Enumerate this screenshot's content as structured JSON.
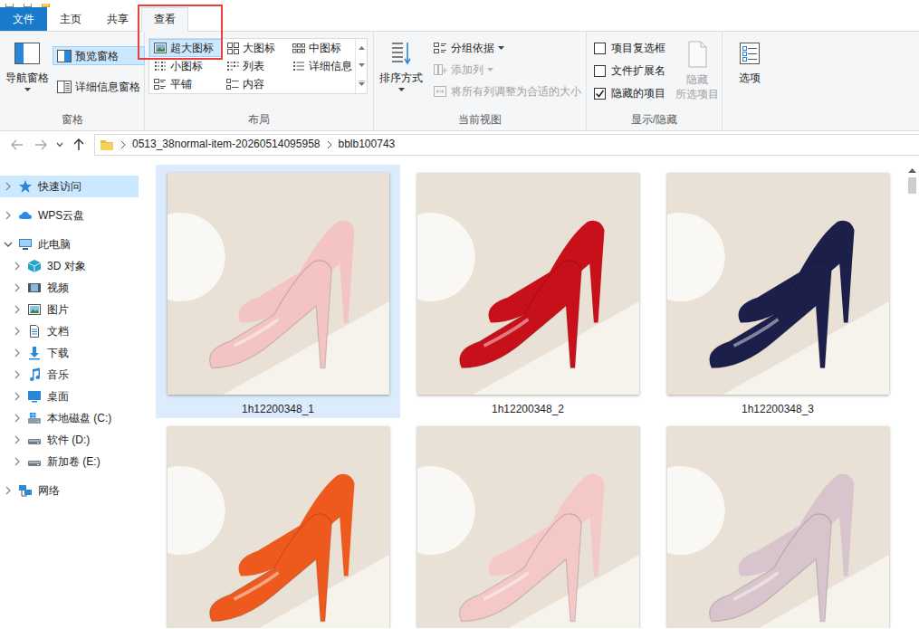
{
  "ribbon": {
    "tabs": [
      {
        "label": "文件",
        "kind": "file",
        "selected": false,
        "annotated": false
      },
      {
        "label": "主页",
        "kind": "tab",
        "selected": false,
        "annotated": false
      },
      {
        "label": "共享",
        "kind": "tab",
        "selected": false,
        "annotated": false
      },
      {
        "label": "查看",
        "kind": "tab",
        "selected": true,
        "annotated": true
      }
    ],
    "panes": {
      "title": "窗格",
      "navigation": {
        "label": "导航窗格"
      },
      "buttons": [
        {
          "label": "预览窗格",
          "selected": true
        },
        {
          "label": "详细信息窗格",
          "selected": false
        }
      ]
    },
    "layout": {
      "title": "布局",
      "options": [
        {
          "label": "超大图标",
          "selected": true
        },
        {
          "label": "大图标",
          "selected": false
        },
        {
          "label": "中图标",
          "selected": false
        },
        {
          "label": "小图标",
          "selected": false
        },
        {
          "label": "列表",
          "selected": false
        },
        {
          "label": "详细信息",
          "selected": false
        },
        {
          "label": "平铺",
          "selected": false
        },
        {
          "label": "内容",
          "selected": false
        }
      ]
    },
    "current_view": {
      "title": "当前视图",
      "sort": {
        "label": "排序方式"
      },
      "buttons": [
        {
          "label": "分组依据",
          "disabled": false,
          "dropdown": true
        },
        {
          "label": "添加列",
          "disabled": true,
          "dropdown": true
        },
        {
          "label": "将所有列调整为合适的大小",
          "disabled": true,
          "dropdown": false
        }
      ]
    },
    "show_hide": {
      "title": "显示/隐藏",
      "checkboxes": [
        {
          "label": "项目复选框",
          "checked": false
        },
        {
          "label": "文件扩展名",
          "checked": false
        },
        {
          "label": "隐藏的项目",
          "checked": true
        }
      ],
      "hide_selected": {
        "lines": [
          "隐藏",
          "所选项目"
        ],
        "disabled": true
      }
    },
    "options": {
      "label": "选项"
    }
  },
  "address": {
    "back_disabled": true,
    "forward_disabled": true,
    "segments": [
      "0513_38normal-item-20260514095958",
      "bblb100743"
    ]
  },
  "nav_pane": {
    "items": [
      {
        "label": "快速访问",
        "depth": 0,
        "expanded": false,
        "selected": true
      },
      {
        "label": "WPS云盘",
        "depth": 0,
        "expanded": false,
        "selected": false
      },
      {
        "label": "此电脑",
        "depth": 0,
        "expanded": true,
        "selected": false
      },
      {
        "label": "3D 对象",
        "depth": 1,
        "expanded": false,
        "selected": false
      },
      {
        "label": "视频",
        "depth": 1,
        "expanded": false,
        "selected": false
      },
      {
        "label": "图片",
        "depth": 1,
        "expanded": false,
        "selected": false
      },
      {
        "label": "文档",
        "depth": 1,
        "expanded": false,
        "selected": false
      },
      {
        "label": "下载",
        "depth": 1,
        "expanded": false,
        "selected": false
      },
      {
        "label": "音乐",
        "depth": 1,
        "expanded": false,
        "selected": false
      },
      {
        "label": "桌面",
        "depth": 1,
        "expanded": false,
        "selected": false
      },
      {
        "label": "本地磁盘 (C:)",
        "depth": 1,
        "expanded": false,
        "selected": false
      },
      {
        "label": "软件 (D:)",
        "depth": 1,
        "expanded": false,
        "selected": false
      },
      {
        "label": "新加卷 (E:)",
        "depth": 1,
        "expanded": false,
        "selected": false
      },
      {
        "label": "网络",
        "depth": 0,
        "expanded": false,
        "selected": false
      }
    ]
  },
  "files": [
    {
      "caption": "1h12200348_1",
      "selected": true,
      "color": "#f3c4c2"
    },
    {
      "caption": "1h12200348_2",
      "selected": false,
      "color": "#c8101a"
    },
    {
      "caption": "1h12200348_3",
      "selected": false,
      "color": "#1c1f4a"
    },
    {
      "selected": false,
      "color": "#ee5a1e"
    },
    {
      "selected": false,
      "color": "#f4c8c6"
    },
    {
      "selected": false,
      "color": "#d8c4cd"
    }
  ]
}
